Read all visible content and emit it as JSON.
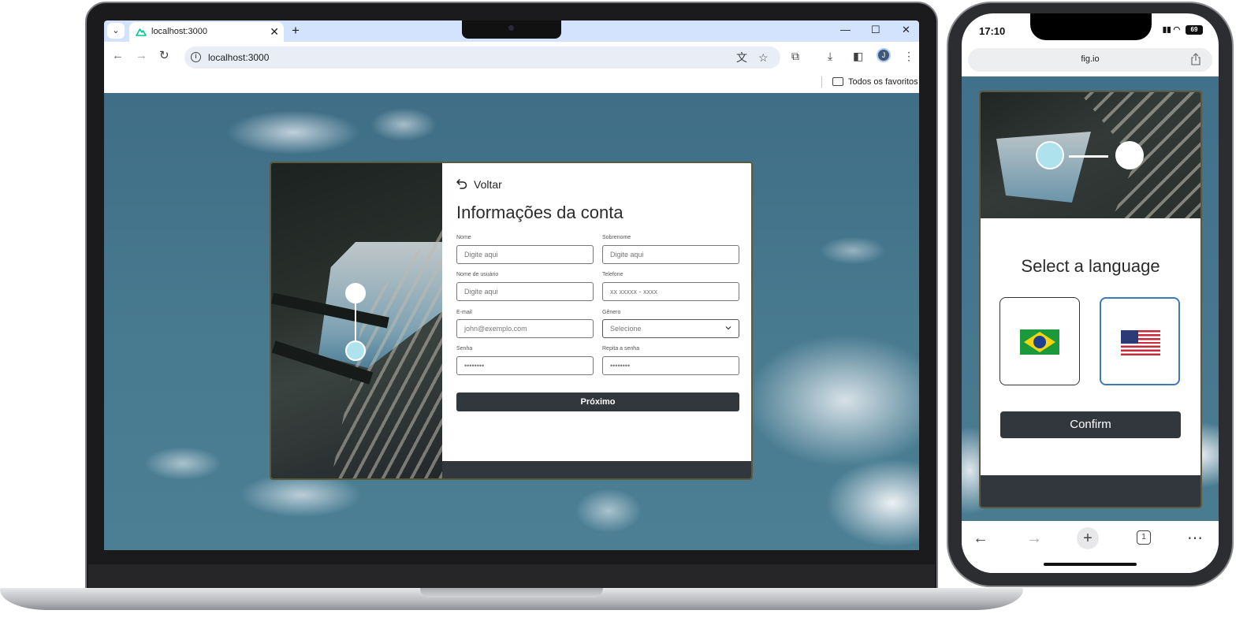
{
  "browser": {
    "tab_title": "localhost:3000",
    "tab_close": "✕",
    "new_tab": "+",
    "url": "localhost:3000",
    "bookmark_folder": "Todos os favoritos",
    "profile_initial": "J",
    "window_minimize": "—",
    "window_maximize": "☐",
    "window_close": "✕"
  },
  "form": {
    "back_label": "Voltar",
    "title": "Informações da conta",
    "fields": [
      {
        "label": "Nome",
        "placeholder": "Digite aqui"
      },
      {
        "label": "Sobrenome",
        "placeholder": "Digite aqui"
      },
      {
        "label": "Nome de usuário",
        "placeholder": "Digite aqui"
      },
      {
        "label": "Telefone",
        "placeholder": "xx xxxxx - xxxx"
      },
      {
        "label": "E-mail",
        "placeholder": "john@exemplo.com"
      },
      {
        "label": "Gênero",
        "placeholder": "Selecione"
      },
      {
        "label": "Senha",
        "placeholder": "••••••••"
      },
      {
        "label": "Repita a senha",
        "placeholder": "••••••••"
      }
    ],
    "next_label": "Próximo",
    "steps": [
      {
        "state": "pending",
        "color": "#ffffff"
      },
      {
        "state": "active",
        "color": "#aee3ee"
      }
    ]
  },
  "phone": {
    "time": "17:10",
    "battery": "69",
    "url": "fig.io",
    "title": "Select a language",
    "languages": [
      {
        "flag": "brazil-flag",
        "selected": false
      },
      {
        "flag": "usa-flag",
        "selected": true
      }
    ],
    "confirm_label": "Confirm",
    "tabs_count": "1",
    "steps": [
      {
        "state": "active",
        "color": "#aee3ee"
      },
      {
        "state": "pending",
        "color": "#ffffff"
      }
    ]
  },
  "colors": {
    "accent": "#aee3ee",
    "button_dark": "#32363d",
    "selected_border": "#3d7ab8",
    "chrome_tabstrip": "#d3e3fd"
  }
}
